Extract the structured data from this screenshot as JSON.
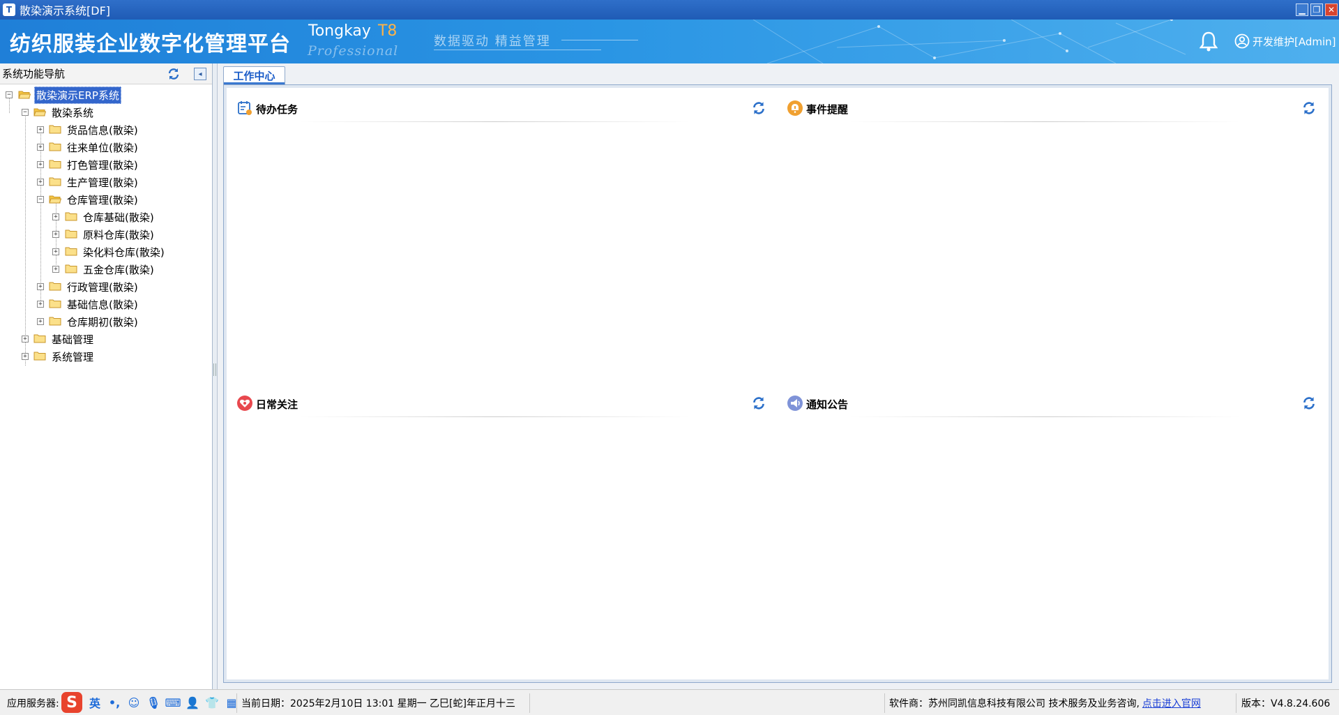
{
  "window": {
    "title": "散染演示系统[DF]"
  },
  "banner": {
    "title": "纺织服装企业数字化管理平台",
    "product": "Tongkay",
    "version": "T8",
    "edition": "Professional",
    "slogan": "数据驱动  精益管理",
    "user": "开发维护[Admin]"
  },
  "nav": {
    "header": "系统功能导航",
    "tree": {
      "root": "散染演示ERP系统",
      "system": "散染系统",
      "items": [
        "货品信息(散染)",
        "往来单位(散染)",
        "打色管理(散染)",
        "生产管理(散染)",
        "仓库管理(散染)"
      ],
      "warehouse_children": [
        "仓库基础(散染)",
        "原料仓库(散染)",
        "染化料仓库(散染)",
        "五金仓库(散染)"
      ],
      "items_after": [
        "行政管理(散染)",
        "基础信息(散染)",
        "仓库期初(散染)"
      ],
      "top_level": [
        "基础管理",
        "系统管理"
      ]
    }
  },
  "main": {
    "tab": "工作中心",
    "panels": {
      "todo": "待办任务",
      "events": "事件提醒",
      "daily": "日常关注",
      "notices": "通知公告"
    }
  },
  "status": {
    "server_label": "应用服务器:",
    "ime_lang": "英",
    "date": "当前日期：2025年2月10日 13:01 星期一 乙巳[蛇]年正月十三",
    "vendor": "软件商：苏州同凯信息科技有限公司  技术服务及业务咨询,",
    "website_link": "点击进入官网",
    "version": "版本：V4.8.24.606"
  },
  "colors": {
    "accent": "#1f7fd8",
    "selected": "#3366cc",
    "tab_text": "#1a5cc8",
    "folder": "#f5c542"
  },
  "icons": {
    "bell": "bell-icon",
    "user": "user-icon",
    "refresh": "refresh-icon",
    "folder": "folder-icon",
    "folder_open": "folder-open-icon"
  }
}
